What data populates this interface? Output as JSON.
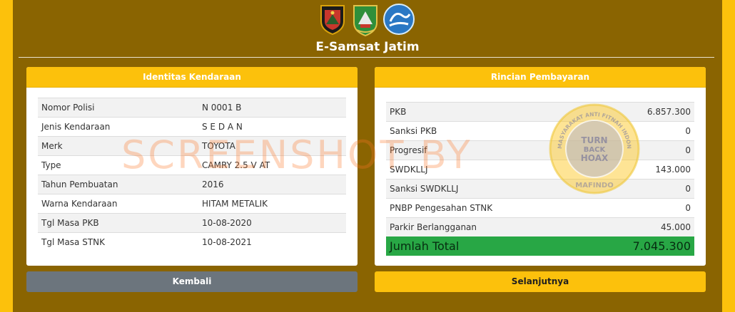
{
  "app_title": "E-Samsat Jatim",
  "logos": [
    "police-emblem",
    "east-java-emblem",
    "jasa-raharja-emblem"
  ],
  "identity": {
    "title": "Identitas Kendaraan",
    "rows": [
      {
        "label": "Nomor Polisi",
        "value": "N 0001 B"
      },
      {
        "label": "Jenis Kendaraan",
        "value": "S E D A N"
      },
      {
        "label": "Merk",
        "value": "TOYOTA"
      },
      {
        "label": "Type",
        "value": "CAMRY 2.5 V AT"
      },
      {
        "label": "Tahun Pembuatan",
        "value": "2016"
      },
      {
        "label": "Warna Kendaraan",
        "value": "HITAM METALIK"
      },
      {
        "label": "Tgl Masa PKB",
        "value": "10-08-2020"
      },
      {
        "label": "Tgl Masa STNK",
        "value": "10-08-2021"
      }
    ]
  },
  "payment": {
    "title": "Rincian Pembayaran",
    "rows": [
      {
        "label": "PKB",
        "value": "6.857.300"
      },
      {
        "label": "Sanksi PKB",
        "value": "0"
      },
      {
        "label": "Progresif",
        "value": "0"
      },
      {
        "label": "SWDKLLJ",
        "value": "143.000"
      },
      {
        "label": "Sanksi SWDKLLJ",
        "value": "0"
      },
      {
        "label": "PNBP Pengesahan STNK",
        "value": "0"
      },
      {
        "label": "Parkir Berlangganan",
        "value": "45.000"
      }
    ],
    "total": {
      "label": "Jumlah Total",
      "value": "7.045.300"
    }
  },
  "buttons": {
    "back": "Kembali",
    "next": "Selanjutnya"
  },
  "watermarks": {
    "overlay_text": "SCREENSHOT BY",
    "stamp_text": [
      "MASYARAKAT ANTI FITNAH INDONESIA",
      "TURN",
      "BACK",
      "HOAX",
      "MAFINDO"
    ]
  },
  "colors": {
    "page_bg": "#fcc10c",
    "frame_bg": "#8a6401",
    "header_bg": "#fcc10c",
    "total_bg": "#28a745",
    "back_button": "#6c757d"
  }
}
